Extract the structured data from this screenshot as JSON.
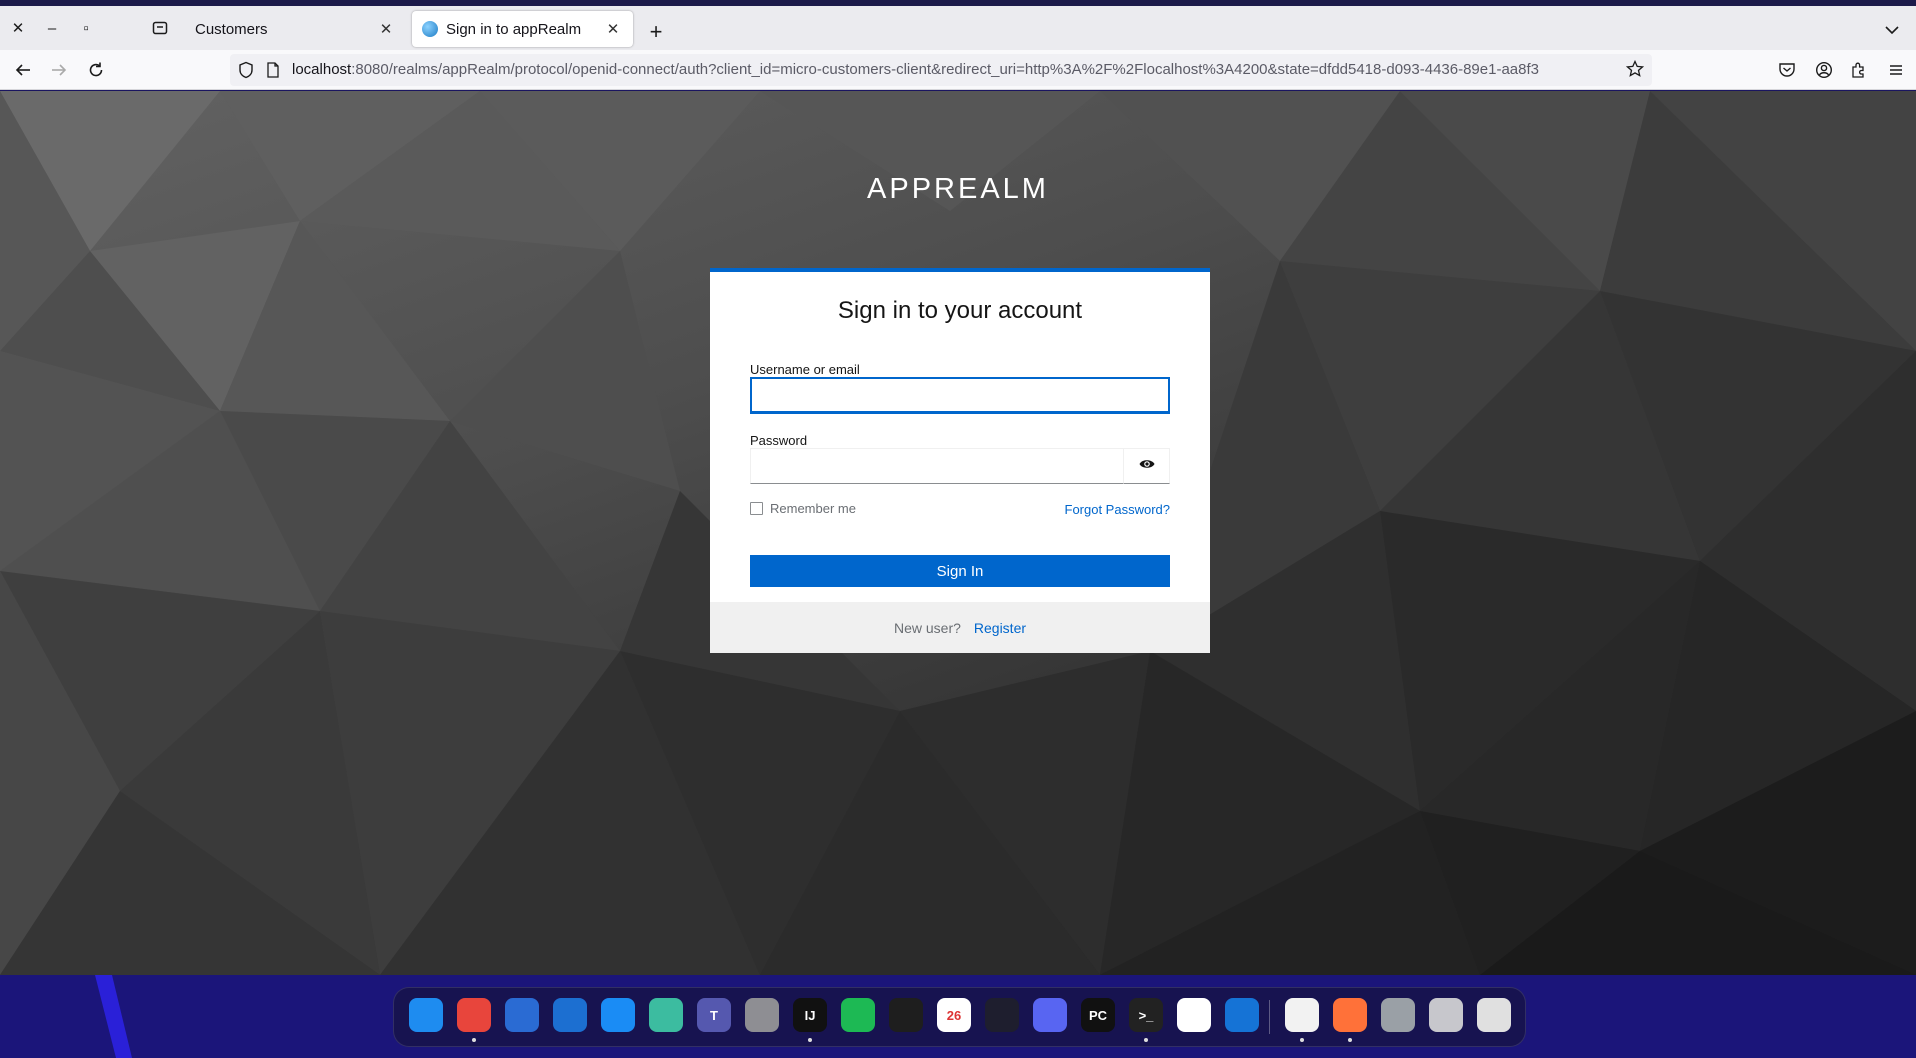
{
  "browser": {
    "tabs": [
      {
        "label": "Customers",
        "active": false
      },
      {
        "label": "Sign in to appRealm",
        "active": true
      }
    ],
    "url": {
      "host": "localhost",
      "rest": ":8080/realms/appRealm/protocol/openid-connect/auth?client_id=micro-customers-client&redirect_uri=http%3A%2F%2Flocalhost%3A4200&state=dfdd5418-d093-4436-89e1-aa8f3"
    }
  },
  "login": {
    "realm_title": "APPREALM",
    "heading": "Sign in to your account",
    "username_label": "Username or email",
    "username_value": "",
    "password_label": "Password",
    "password_value": "",
    "remember_label": "Remember me",
    "remember_checked": false,
    "forgot_label": "Forgot Password?",
    "signin_label": "Sign In",
    "new_user_text": "New user?",
    "register_label": "Register"
  },
  "colors": {
    "accent": "#0066cc",
    "page_background": "#3a3a3a",
    "desktop_background": "#1b157a"
  },
  "dock": {
    "apps": [
      {
        "name": "finder-icon",
        "color": "#1e8cf0",
        "glyph": ""
      },
      {
        "name": "chrome-icon",
        "color": "#e8453c",
        "glyph": ""
      },
      {
        "name": "thunderbird-icon",
        "color": "#2a6bd3",
        "glyph": ""
      },
      {
        "name": "text-editor-icon",
        "color": "#1c6fd1",
        "glyph": ""
      },
      {
        "name": "app-store-icon",
        "color": "#1a8cf5",
        "glyph": ""
      },
      {
        "name": "chatgpt-icon",
        "color": "#3cbca0",
        "glyph": ""
      },
      {
        "name": "teams-icon",
        "color": "#5558af",
        "glyph": "T"
      },
      {
        "name": "settings-icon",
        "color": "#8e8e93",
        "glyph": ""
      },
      {
        "name": "intellij-icon",
        "color": "#111111",
        "glyph": "IJ"
      },
      {
        "name": "spotify-icon",
        "color": "#1db954",
        "glyph": ""
      },
      {
        "name": "figma-icon",
        "color": "#1e1e1e",
        "glyph": ""
      },
      {
        "name": "calendar-icon",
        "color": "#ffffff",
        "glyph": "26"
      },
      {
        "name": "vscode-icon",
        "color": "#1e1e2e",
        "glyph": ""
      },
      {
        "name": "discord-icon",
        "color": "#5865f2",
        "glyph": ""
      },
      {
        "name": "pycharm-icon",
        "color": "#111111",
        "glyph": "PC"
      },
      {
        "name": "terminal-icon",
        "color": "#222222",
        "glyph": ">_"
      },
      {
        "name": "webstorm-icon",
        "color": "#ffffff",
        "glyph": ""
      },
      {
        "name": "xcode-icon",
        "color": "#1573d6",
        "glyph": ""
      },
      {
        "name": "textedit-icon",
        "color": "#f2f2f2",
        "glyph": ""
      },
      {
        "name": "firefox-icon",
        "color": "#ff7139",
        "glyph": ""
      },
      {
        "name": "disk-utility-icon",
        "color": "#9aa0a6",
        "glyph": ""
      },
      {
        "name": "trash-icon",
        "color": "#c7c7cc",
        "glyph": ""
      },
      {
        "name": "launchpad-icon",
        "color": "#e0e0e0",
        "glyph": ""
      }
    ]
  }
}
